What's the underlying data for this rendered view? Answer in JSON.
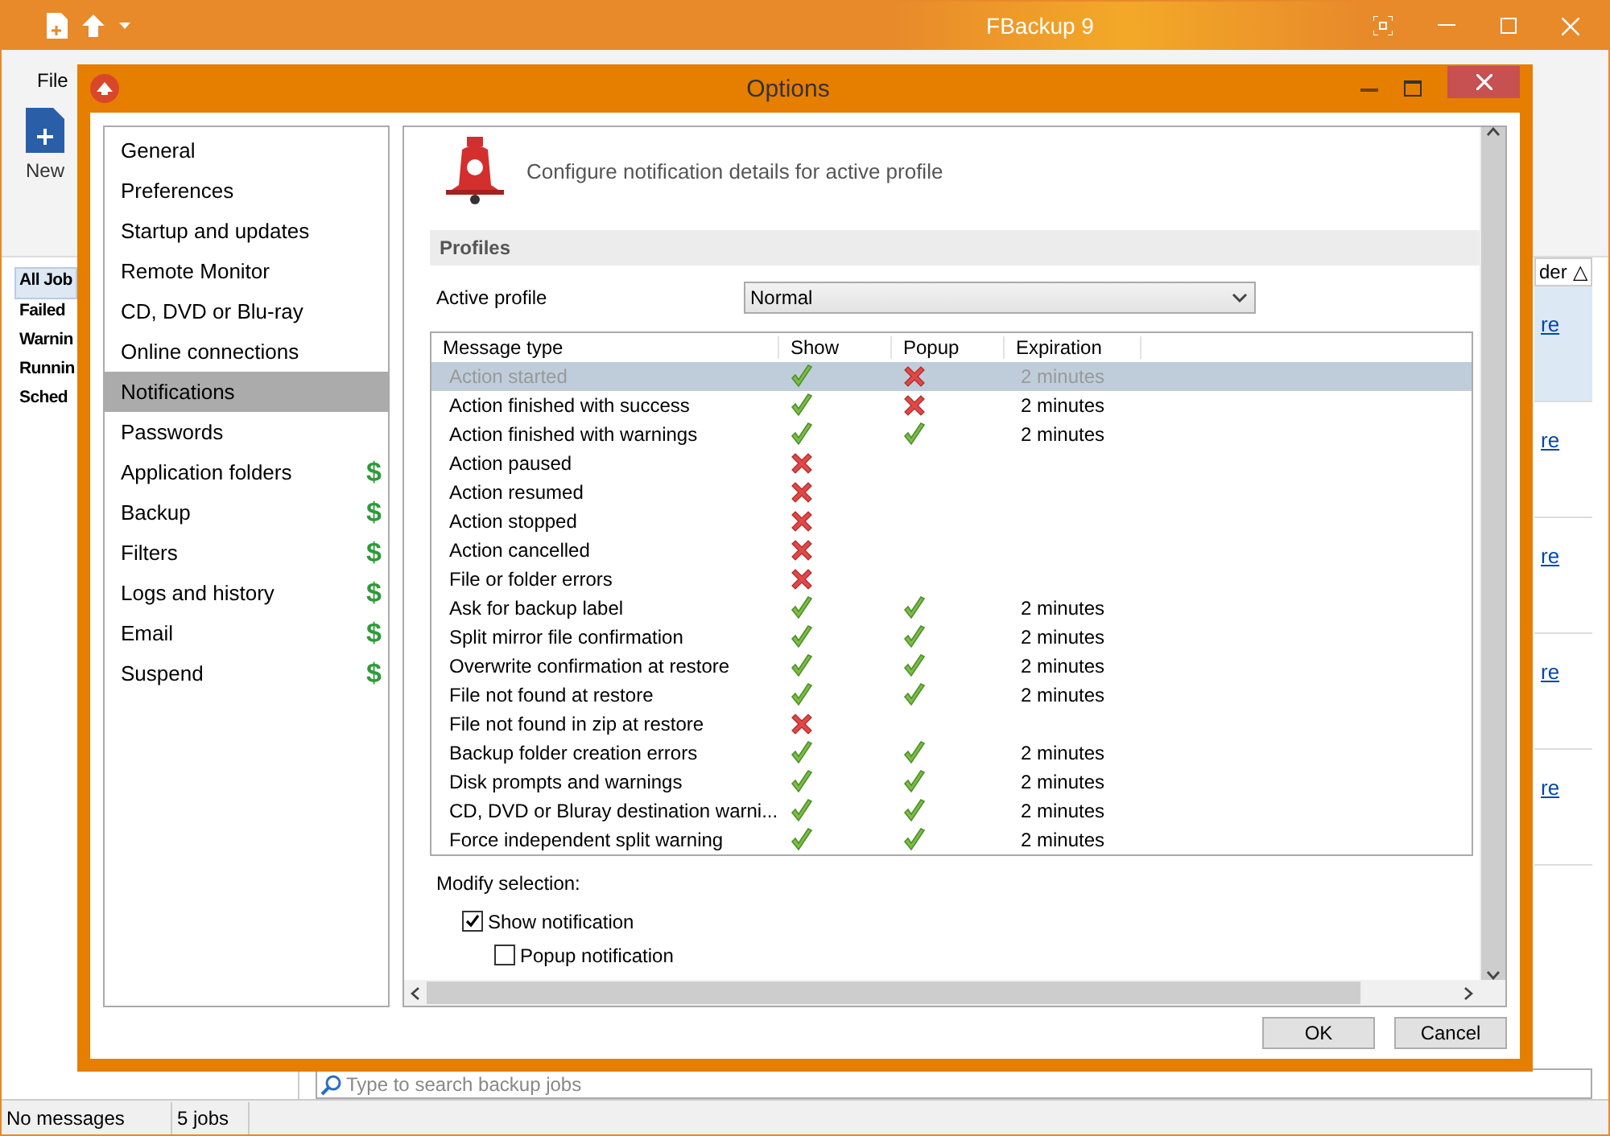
{
  "app": {
    "title": "FBackup 9",
    "menu_tab": "File",
    "new_button": "New",
    "job_filters": [
      {
        "label": "All Job",
        "selected": true
      },
      {
        "label": "Failed",
        "selected": false
      },
      {
        "label": "Warnin",
        "selected": false
      },
      {
        "label": "Runnin",
        "selected": false
      },
      {
        "label": "Sched",
        "selected": false
      }
    ],
    "column_header": "der",
    "sort_indicator": "△",
    "job_links": [
      "re",
      "re",
      "re",
      "re",
      "re"
    ],
    "search": {
      "placeholder": "Type to search backup jobs"
    },
    "status_bar": [
      "No messages",
      "5 jobs"
    ]
  },
  "dialog": {
    "title": "Options",
    "nav": [
      {
        "label": "General",
        "selected": false
      },
      {
        "label": "Preferences",
        "selected": false
      },
      {
        "label": "Startup and updates",
        "selected": false
      },
      {
        "label": "Remote Monitor",
        "selected": false
      },
      {
        "label": "CD, DVD or Blu-ray",
        "selected": false
      },
      {
        "label": "Online connections",
        "selected": false
      },
      {
        "label": "Notifications",
        "selected": true
      },
      {
        "label": "Passwords",
        "selected": false
      },
      {
        "label": "Application folders",
        "selected": false,
        "badge": "$"
      },
      {
        "label": "Backup",
        "selected": false,
        "badge": "$"
      },
      {
        "label": "Filters",
        "selected": false,
        "badge": "$"
      },
      {
        "label": "Logs and history",
        "selected": false,
        "badge": "$"
      },
      {
        "label": "Email",
        "selected": false,
        "badge": "$"
      },
      {
        "label": "Suspend",
        "selected": false,
        "badge": "$"
      }
    ],
    "heading": "Configure notification details for active profile",
    "section": "Profiles",
    "active_profile": {
      "label": "Active profile",
      "value": "Normal"
    },
    "table": {
      "columns": [
        "Message type",
        "Show",
        "Popup",
        "Expiration"
      ],
      "rows": [
        {
          "message": "Action started",
          "show": true,
          "popup": false,
          "expiration": "2 minutes",
          "selected": true
        },
        {
          "message": "Action finished with success",
          "show": true,
          "popup": false,
          "expiration": "2 minutes",
          "selected": false
        },
        {
          "message": "Action finished with warnings",
          "show": true,
          "popup": true,
          "expiration": "2 minutes",
          "selected": false
        },
        {
          "message": "Action paused",
          "show": false,
          "selected": false
        },
        {
          "message": "Action resumed",
          "show": false,
          "selected": false
        },
        {
          "message": "Action stopped",
          "show": false,
          "selected": false
        },
        {
          "message": "Action cancelled",
          "show": false,
          "selected": false
        },
        {
          "message": "File or folder errors",
          "show": false,
          "selected": false
        },
        {
          "message": "Ask for backup label",
          "show": true,
          "popup": true,
          "expiration": "2 minutes",
          "selected": false
        },
        {
          "message": "Split mirror file confirmation",
          "show": true,
          "popup": true,
          "expiration": "2 minutes",
          "selected": false
        },
        {
          "message": "Overwrite confirmation at restore",
          "show": true,
          "popup": true,
          "expiration": "2 minutes",
          "selected": false
        },
        {
          "message": "File not found at restore",
          "show": true,
          "popup": true,
          "expiration": "2 minutes",
          "selected": false
        },
        {
          "message": "File not found in zip at restore",
          "show": false,
          "selected": false
        },
        {
          "message": "Backup folder creation errors",
          "show": true,
          "popup": true,
          "expiration": "2 minutes",
          "selected": false
        },
        {
          "message": "Disk prompts and warnings",
          "show": true,
          "popup": true,
          "expiration": "2 minutes",
          "selected": false
        },
        {
          "message": "CD, DVD or Bluray destination warni...",
          "show": true,
          "popup": true,
          "expiration": "2 minutes",
          "selected": false
        },
        {
          "message": "Force independent split warning",
          "show": true,
          "popup": true,
          "expiration": "2 minutes",
          "selected": false
        }
      ]
    },
    "modify_label": "Modify selection:",
    "options": [
      {
        "label": "Show notification",
        "checked": true
      },
      {
        "label": "Popup notification",
        "checked": false
      }
    ],
    "buttons": [
      "OK",
      "Cancel"
    ]
  }
}
